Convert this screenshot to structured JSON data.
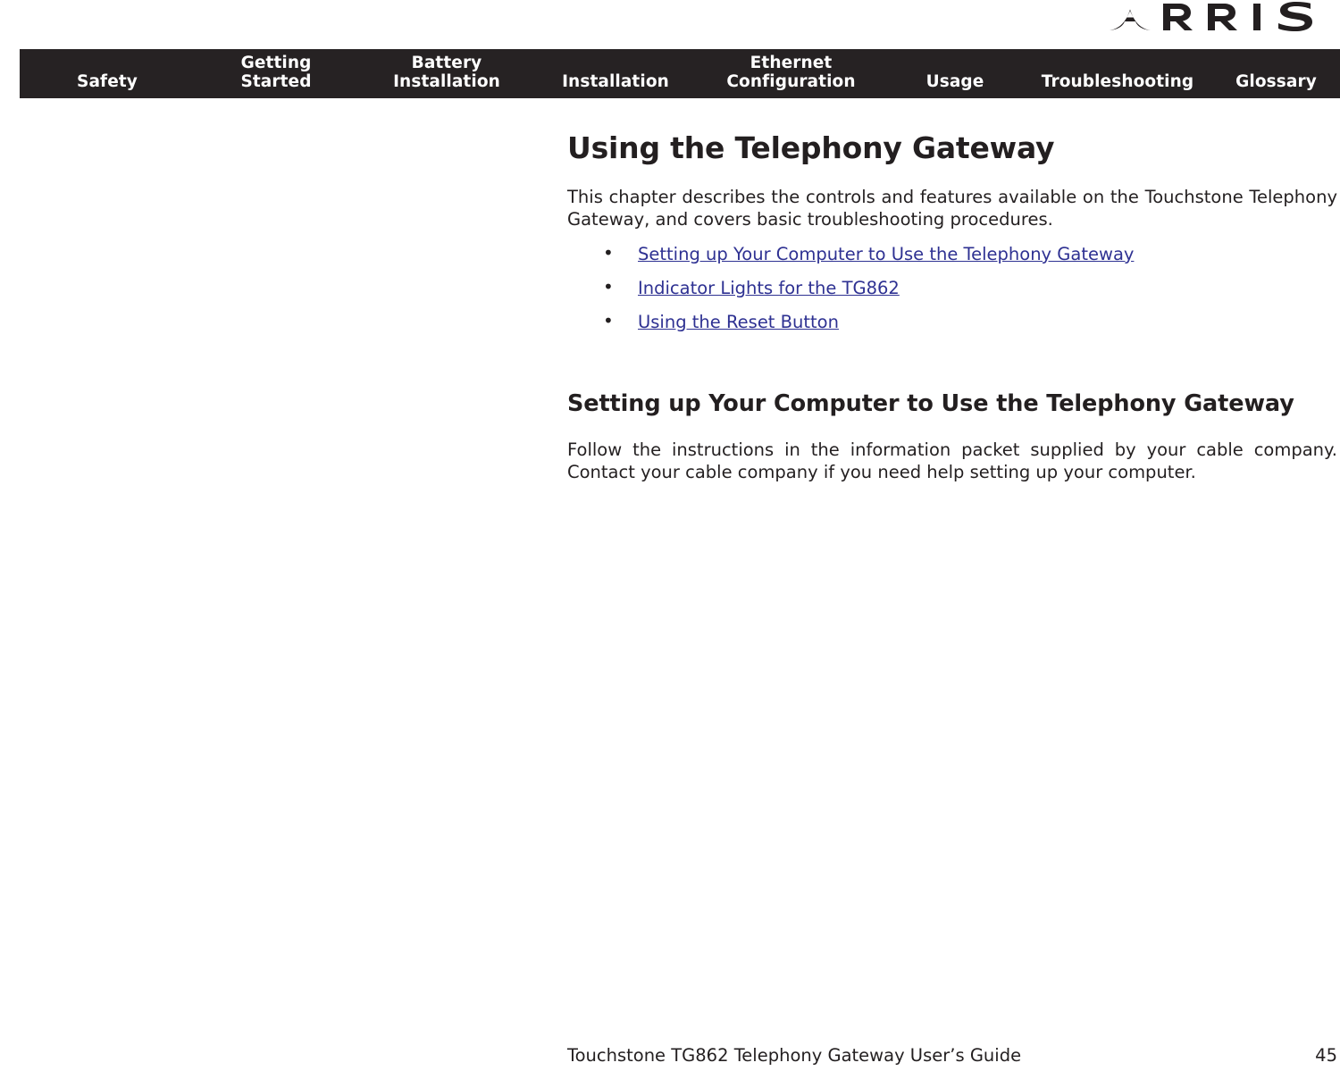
{
  "brand": {
    "logo_text": "ARRIS",
    "logo_letters": [
      "A",
      "R",
      "R",
      "I",
      "S"
    ],
    "logo_color": "#231f20"
  },
  "nav": {
    "background_color": "#262223",
    "text_color": "#ffffff",
    "items": [
      {
        "label": "Safety"
      },
      {
        "label": "Getting\nStarted"
      },
      {
        "label": "Battery\nInstallation"
      },
      {
        "label": "Installation"
      },
      {
        "label": "Ethernet\nConfiguration"
      },
      {
        "label": "Usage"
      },
      {
        "label": "Troubleshooting"
      },
      {
        "label": "Glossary"
      }
    ]
  },
  "content": {
    "chapter_title": "Using the Telephony Gateway",
    "intro_paragraph": "This chapter describes the controls and features available on the Touchstone Telephony Gateway, and covers basic troubleshooting procedures.",
    "link_color": "#2e3192",
    "links": [
      {
        "label": "Setting up Your Computer to Use the Telephony Gateway"
      },
      {
        "label": "Indicator Lights for the TG862"
      },
      {
        "label": "Using the Reset Button"
      }
    ],
    "section_title": "Setting up Your Computer to Use the Telephony Gateway",
    "section_paragraph": "Follow the instructions in the information packet supplied by your cable company. Contact your cable company if you need help setting up your computer."
  },
  "footer": {
    "guide_title": "Touchstone TG862 Telephony Gateway User’s Guide",
    "page_number": "45"
  }
}
